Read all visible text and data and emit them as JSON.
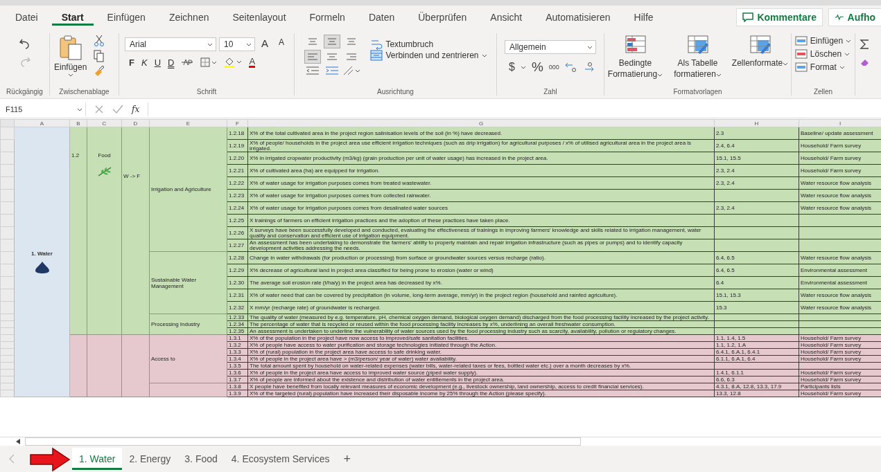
{
  "menu": {
    "tabs": [
      {
        "label": "Datei",
        "selected": false
      },
      {
        "label": "Start",
        "selected": true
      },
      {
        "label": "Einfügen",
        "selected": false
      },
      {
        "label": "Zeichnen",
        "selected": false
      },
      {
        "label": "Seitenlayout",
        "selected": false
      },
      {
        "label": "Formeln",
        "selected": false
      },
      {
        "label": "Daten",
        "selected": false
      },
      {
        "label": "Überprüfen",
        "selected": false
      },
      {
        "label": "Ansicht",
        "selected": false
      },
      {
        "label": "Automatisieren",
        "selected": false
      },
      {
        "label": "Hilfe",
        "selected": false
      }
    ],
    "comments": "Kommentare",
    "record": "Aufho"
  },
  "ribbon": {
    "undo": {
      "label": "Rückgängig"
    },
    "clipboard": {
      "label": "Zwischenablage",
      "paste": "Einfügen"
    },
    "font": {
      "label": "Schrift",
      "family": "Arial",
      "size": "10",
      "grow": "A",
      "shrink": "A",
      "styles": [
        "F",
        "K",
        "U",
        "D"
      ],
      "color_letter": "A"
    },
    "alignment": {
      "label": "Ausrichtung",
      "wrap": "Textumbruch",
      "merge": "Verbinden und zentrieren",
      "align_buttons": [
        {
          "selected": false
        },
        {
          "selected": true
        },
        {
          "selected": false
        },
        {
          "selected": true
        },
        {
          "selected": false
        },
        {
          "selected": false
        }
      ]
    },
    "number": {
      "label": "Zahl",
      "format": "Allgemein",
      "currency": "$",
      "percent": "%",
      "thousands": "000"
    },
    "styles": {
      "label": "Formatvorlagen",
      "buttons": [
        "Bedingte Formatierung",
        "Als Tabelle formatieren",
        "Zellenformate"
      ]
    },
    "cells": {
      "label": "Zellen",
      "buttons": [
        "Einfügen",
        "Löschen",
        "Format"
      ]
    }
  },
  "formula_bar": {
    "name_box": "F115",
    "fx": "fx"
  },
  "sheet": {
    "columns": [
      "A",
      "B",
      "C",
      "D",
      "E",
      "F",
      "G",
      "H",
      "I"
    ],
    "area": "1. Water",
    "blocks": [
      {
        "color": "#c6dfb4",
        "number": "1.2",
        "sector": "Food",
        "link": "W -> F",
        "groups": [
          {
            "label": "Irrigation and Agriculture",
            "rows": [
              {
                "id": "1.2.18",
                "text": "X% of the total cultivated area in the project region salinisation levels of the soil (in %) have decreased.",
                "sdg": "2.3",
                "method": "Baseline/ update assessment"
              },
              {
                "id": "1.2.19",
                "text": "X% of people/ households in the project area use efficient irrigation techniques (such as drip irrigation) for agricultural purposes / x% of utilised agricultural area in the project area is irrigated.",
                "sdg": "2.4, 6.4",
                "method": "Household/ Farm survey"
              },
              {
                "id": "1.2.20",
                "text": "X% in irrigated cropwater productivity (m3/kg) (grain production per unit of water usage) has increased in the project area.",
                "sdg": "15.1, 15.5",
                "method": "Household/ Farm survey"
              },
              {
                "id": "1.2.21",
                "text": "X% of cultivated area (ha) are equipped for irrigation.",
                "sdg": "2.3, 2.4",
                "method": "Household/ Farm survey"
              },
              {
                "id": "1.2.22",
                "text": "X% of water usage for irrigation purposes comes from treated wastewater.",
                "sdg": "2.3, 2.4",
                "method": "Water resource flow analysis"
              },
              {
                "id": "1.2.23",
                "text": "X% of water usage for irrigation purposes comes from collected rainwater.",
                "method": "Water resource flow analysis"
              },
              {
                "id": "1.2.24",
                "text": "X% of water usage for irrigation purposes comes from desalinated water sources",
                "sdg": "2.3, 2.4",
                "method": "Water resource flow analysis"
              },
              {
                "id": "1.2.25",
                "text": "X trainings of farmers on efficient irrigation practices and the adoption of these practices have taken place."
              },
              {
                "id": "1.2.26",
                "text": "X surveys have been successfully developed and conducted, evaluating the effectiveness of trainings in improving farmers' knowledge and skills related to irrigation management, water quality and conservation and efficient use of irrigation equipment."
              },
              {
                "id": "1.2.27",
                "text": "An assessment has been undertaking to demonstrate the farmers' ability to properly maintain and repair irrigation infrastructure (such as pipes or pumps) and to identify capacity development activities addressing the needs."
              }
            ]
          },
          {
            "label": "Sustainable Water Management",
            "rows": [
              {
                "id": "1.2.28",
                "text": "Change in water withdrawals (for production or processing) from surface or groundwater sources versus recharge (ratio).",
                "sdg": "6.4, 6.5",
                "method": "Water resource flow analysis"
              },
              {
                "id": "1.2.29",
                "text": "X% decrease of agricultural land in project area classified for being prone to erosion (water or wind)",
                "sdg": "6.4, 6.5",
                "method": "Environmental assessment"
              },
              {
                "id": "1.2.30",
                "text": "The average soil erosion rate (t/ha/y) in the project area has decreased by x%.",
                "sdg": "6.4",
                "method": "Environmental assessment"
              },
              {
                "id": "1.2.31",
                "text": "X% of water need that can be covered by precipitation (in volume, long-term average, mm/yr) in the project region (household and rainfed agriculture).",
                "sdg": "15.1, 15.3",
                "method": "Water resource flow analysis"
              },
              {
                "id": "1.2.32",
                "text": "X mm/yr (recharge rate) of groundwater is recharged.",
                "sdg": "15.3",
                "method": "Water resource flow analysis"
              }
            ]
          },
          {
            "label": "Processing Industry",
            "rows": [
              {
                "id": "1.2.33",
                "text": "The quality of water (measured by e.g. temperature, pH, chemical oxygen demand, biological oxygen demand) discharged from the food processing facility increased by the project activity."
              },
              {
                "id": "1.2.34",
                "text": "The percentage of water that is recycled or reused within the food processing facility increases by x%, underlining an overall freshwater consumption."
              },
              {
                "id": "1.2.35",
                "text": "An assessment is undertaken to underline the vulnerability of water sources used by the food processing industry such as scarcity, availability, pollution or regulatory changes."
              }
            ]
          }
        ]
      },
      {
        "color": "#e6c9ce",
        "groups": [
          {
            "label": "Access to",
            "rows": [
              {
                "id": "1.3.1",
                "text": "X% of the population in the project have now access to improved/safe sanitation facilities.",
                "sdg": "1.1, 1.4, 1.5",
                "method": "Household/ Farm survey"
              },
              {
                "id": "1.3.2",
                "text": "X% of people have access to water purification and storage technologies initiated through the Action.",
                "sdg": "1.1, 1.2, 1.A",
                "method": "Household/ Farm survey"
              },
              {
                "id": "1.3.3",
                "text": "X% of (rural) population in the project area have access to safe drinking water.",
                "sdg": "6.4.1, 6.A.1, 6.4.1",
                "method": "Household/ Farm survey"
              },
              {
                "id": "1.3.4",
                "text": "X% of people in the project area have > (m3/person/ year of water) water availability.",
                "sdg": "6.1.1, 6.A.1, 6.4",
                "method": "Household/ Farm survey"
              },
              {
                "id": "1.3.5",
                "text": "The total amount spent by household on water-related expenses (water bills, water-related taxes or fees, bottled water etc.) over a month decreases by x%."
              },
              {
                "id": "1.3.6",
                "text": "X% of people in the project area have access to improved water source (piped water supply).",
                "sdg": "1.4.1, 6.1.1",
                "method": "Household/ Farm survey"
              },
              {
                "id": "1.3.7",
                "text": "X% of people are informed about the existence and distribution of water entitlements in the project area.",
                "sdg": "6.6, 6.3",
                "method": "Household/ Farm survey"
              }
            ]
          },
          {
            "rows": [
              {
                "id": "1.3.8",
                "text": "X people have benefited from locally relevant measures of economic development (e.g., livestock ownership, land ownership, access to credit financial services).",
                "sdg": "4.3.1, 8.A, 12.8, 13.3, 17.9",
                "method": "Participants lists"
              },
              {
                "id": "1.3.9",
                "text": "X% of the targeted (rural) population have increased their disposable income by 25% through the Action (please specify).",
                "sdg": "13.3, 12.8",
                "method": "Household/ Farm survey"
              }
            ]
          }
        ]
      }
    ]
  },
  "sheet_tabs": {
    "tabs": [
      {
        "label": "1. Water",
        "selected": true
      },
      {
        "label": "2. Energy",
        "selected": false
      },
      {
        "label": "3. Food",
        "selected": false
      },
      {
        "label": "4. Ecosystem Services",
        "selected": false
      }
    ],
    "add": "+"
  }
}
